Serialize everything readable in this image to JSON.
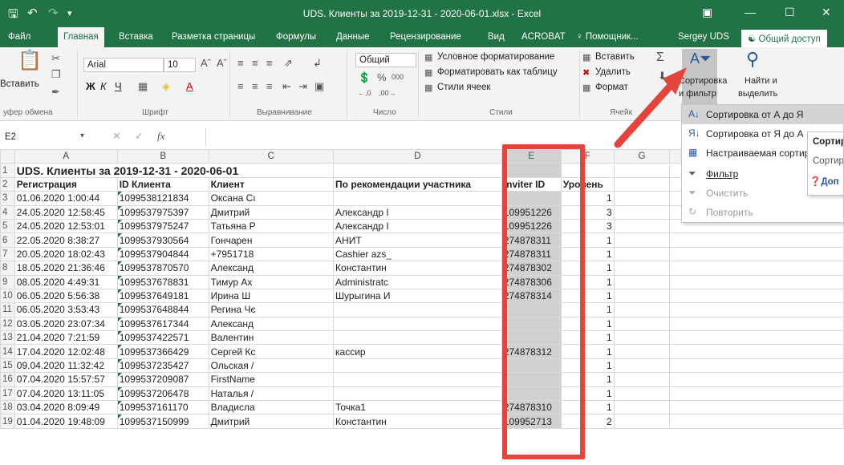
{
  "title": "UDS. Клиенты за 2019-12-31 - 2020-06-01.xlsx - Excel",
  "tabs": [
    "Файл",
    "Главная",
    "Вставка",
    "Разметка страницы",
    "Формулы",
    "Данные",
    "Рецензирование",
    "Вид",
    "ACROBAT",
    "♀ Помощник..."
  ],
  "user": "Sergey UDS",
  "share": "Общий доступ",
  "ribbon": {
    "paste": "Вставить",
    "font_name": "Arial",
    "font_size": "10",
    "number_format": "Общий",
    "cond_format": "Условное форматирование",
    "format_table": "Форматировать как таблицу",
    "cell_styles": "Стили ячеек",
    "insert": "Вставить",
    "delete": "Удалить",
    "format": "Формат",
    "sort_filter_1": "Сортировка",
    "sort_filter_2": "и фильтр",
    "find_1": "Найти и",
    "find_2": "выделить",
    "groups": [
      "уфер обмена",
      "Шрифт",
      "Выравнивание",
      "Число",
      "Стили",
      "Ячейк"
    ]
  },
  "formula": {
    "cell_ref": "E2",
    "value": ""
  },
  "columns": [
    "A",
    "B",
    "C",
    "D",
    "E",
    "F",
    "G"
  ],
  "title_row": "UDS. Клиенты за 2019-12-31 - 2020-06-01",
  "headers": [
    "Регистрация",
    "ID Клиента",
    "Клиент",
    "По рекомендации участника",
    "Inviter ID",
    "Уровень"
  ],
  "rows": [
    [
      "01.06.2020 1:00:44",
      "1099538121834",
      "Оксана Сı",
      "",
      "",
      "1"
    ],
    [
      "24.05.2020 12:58:45",
      "1099537975397",
      "Дмитрий",
      "Александр I",
      "109951226",
      "3"
    ],
    [
      "24.05.2020 12:53:01",
      "1099537975247",
      "Татьяна Р",
      "Александр I",
      "109951226",
      "3"
    ],
    [
      "22.05.2020 8:38:27",
      "1099537930564",
      "Гончарен",
      "АНИТ",
      "274878311",
      "1"
    ],
    [
      "20.05.2020 18:02:43",
      "1099537904844",
      "+7951718",
      "Cashier azs_",
      "274878311",
      "1"
    ],
    [
      "18.05.2020 21:36:46",
      "1099537870570",
      "Александ",
      "Константин",
      "274878302",
      "1"
    ],
    [
      "08.05.2020 4:49:31",
      "1099537678831",
      "Тимур Ах",
      "Administratc",
      "274878306",
      "1"
    ],
    [
      "06.05.2020 5:56:38",
      "1099537649181",
      "Ирина Ш",
      "Шурыгина И",
      "274878314",
      "1"
    ],
    [
      "06.05.2020 3:53:43",
      "1099537648844",
      "Регина Чє",
      "",
      "",
      "1"
    ],
    [
      "03.05.2020 23:07:34",
      "1099537617344",
      "Александ",
      "",
      "",
      "1"
    ],
    [
      "21.04.2020 7:21:59",
      "1099537422571",
      "Валентин",
      "",
      "",
      "1"
    ],
    [
      "17.04.2020 12:02:48",
      "1099537366429",
      "Сергей Кс",
      "кассир",
      "274878312",
      "1"
    ],
    [
      "09.04.2020 11:32:42",
      "1099537235427",
      "Ольская /",
      "",
      "",
      "1"
    ],
    [
      "07.04.2020 15:57:57",
      "1099537209087",
      "FirstName",
      "",
      "",
      "1"
    ],
    [
      "07.04.2020 13:11:05",
      "1099537206478",
      "Наталья /",
      "",
      "",
      "1"
    ],
    [
      "03.04.2020 8:09:49",
      "1099537161170",
      "Владисла",
      "Точка1",
      "274878310",
      "1"
    ],
    [
      "01.04.2020 19:48:09",
      "1099537150999",
      "Дмитрий",
      "Константин",
      "109952713",
      "2"
    ]
  ],
  "menu": [
    "Сортировка от А до Я",
    "Сортировка от Я до А",
    "Настраиваемая сортировка...",
    "Фильтр",
    "Очистить",
    "Повторить"
  ],
  "submenu": [
    "Сортиро",
    "Сортиро",
    "Доп"
  ],
  "colors": {
    "excel_green": "#217346",
    "highlight": "#e3453c"
  }
}
